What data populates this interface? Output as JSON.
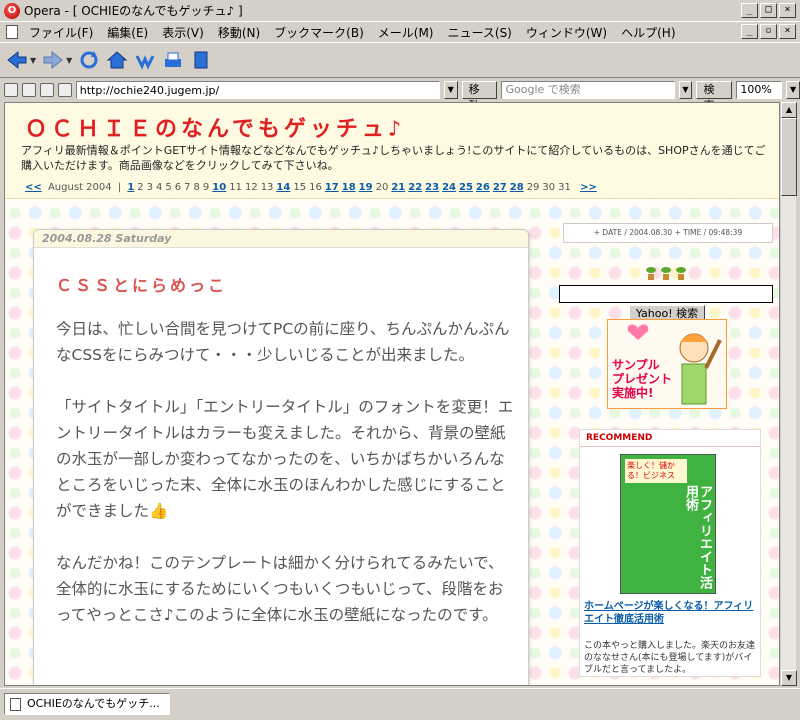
{
  "window": {
    "title": "Opera - [ OCHIEのなんでもゲッチュ♪ ]",
    "buttons": [
      "_",
      "□",
      "×"
    ]
  },
  "menu": {
    "items": [
      "ファイル(F)",
      "編集(E)",
      "表示(V)",
      "移動(N)",
      "ブックマーク(B)",
      "メール(M)",
      "ニュース(S)",
      "ウィンドウ(W)",
      "ヘルプ(H)"
    ],
    "mdi_buttons": [
      "_",
      "▫",
      "×"
    ]
  },
  "address_bar": {
    "url": "http://ochie240.jugem.jp/",
    "go_label": "移動",
    "search_placeholder": "Google で検索",
    "search_button": "検索",
    "zoom": "100%"
  },
  "header": {
    "site_title": "ＯＣＨＩＥのなんでもゲッチュ♪",
    "description": "アフィリ最新情報＆ポイントGETサイト情報などなどなんでもゲッチュ♪しちゃいましょう!このサイトにて紹介しているものは、SHOPさんを通じてご購入いただけます。商品画像などをクリックしてみて下さいね。",
    "calendar": {
      "prev": "<<",
      "month": "August 2004",
      "sep": "|",
      "next": ">>",
      "days": [
        "1",
        "2",
        "3",
        "4",
        "5",
        "6",
        "7",
        "8",
        "9",
        "10",
        "11",
        "12",
        "13",
        "14",
        "15",
        "16",
        "17",
        "18",
        "19",
        "20",
        "21",
        "22",
        "23",
        "24",
        "25",
        "26",
        "27",
        "28",
        "29",
        "30",
        "31"
      ],
      "linked_days": [
        "1",
        "10",
        "14",
        "17",
        "18",
        "19",
        "21",
        "22",
        "23",
        "24",
        "25",
        "26",
        "27",
        "28"
      ]
    }
  },
  "entry": {
    "date": "2004.08.28 Saturday",
    "title": "ＣＳＳとにらめっこ",
    "paragraphs": [
      "今日は、忙しい合間を見つけてPCの前に座り、ちんぷんかんぷんなCSSをにらみつけて・・・少しいじることが出来ました。",
      "「サイトタイトル」「エントリータイトル」のフォントを変更！エントリータイトルはカラーも変えました。それから、背景の壁紙の水玉が一部しか変わってなかったのを、いちかばちかいろんなところをいじった末、全体に水玉のほんわかした感じにすることができました👍",
      "なんだかね！このテンプレートは細かく分けられてるみたいで、全体的に水玉にするためにいくつもいくつもいじって、段階をおってやっとこさ♪このように全体に水玉の壁紙になったのです。"
    ]
  },
  "sidebar": {
    "datetime": "+ DATE / 2004.08.30 + TIME / 09:48:39",
    "yahoo_button": "Yahoo! 検索",
    "present_banner": "サンプル\nプレゼント\n実施中!",
    "recommend": {
      "heading": "RECOMMEND",
      "book_title": "アフィリエイト活用術",
      "book_tagline": "楽しく！儲かる！ビジネス",
      "link_text": "ホームページが楽しくなる！アフィリエイト徹底活用術",
      "text": "この本やっと購入しました。楽天のお友達のななせさん(本にも登場してます)がバイブルだと言ってましたよ。"
    }
  },
  "taskbar": {
    "tab_label": "OCHIEのなんでもゲッチ..."
  },
  "colors": {
    "title_red": "#e02020",
    "link_blue": "#0a5ca8",
    "entry_title": "#d9534f",
    "chrome": "#d4d0c8"
  }
}
